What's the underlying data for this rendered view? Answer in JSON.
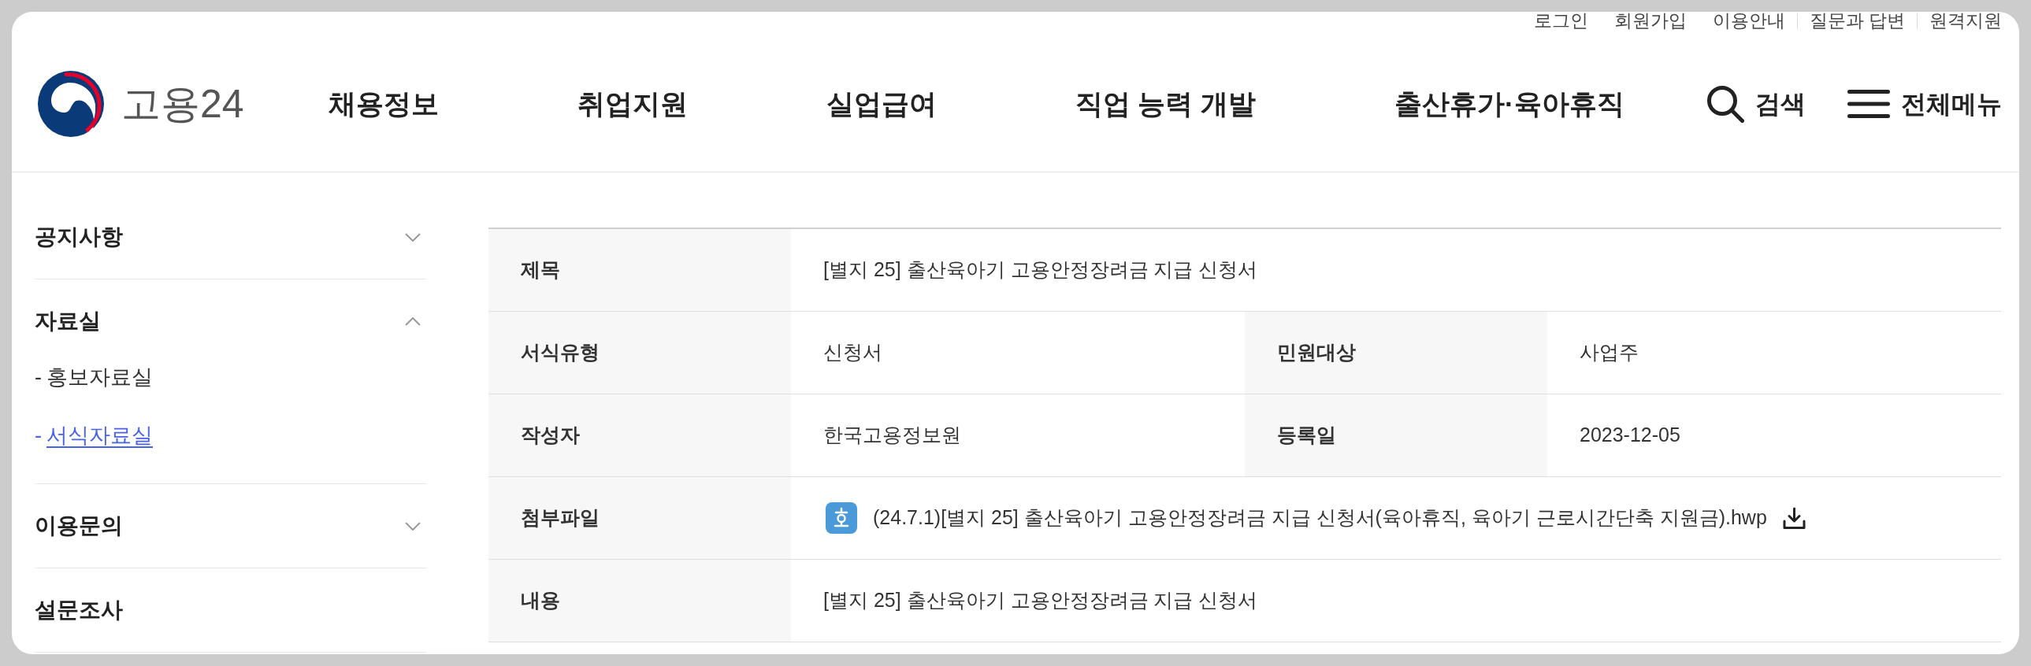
{
  "utility_links": [
    "로그인",
    "회원가입",
    "이용안내",
    "질문과 답변",
    "원격지원"
  ],
  "logo": {
    "text": "고용24"
  },
  "nav": [
    "채용정보",
    "취업지원",
    "실업급여",
    "직업 능력 개발",
    "출산휴가·육아휴직"
  ],
  "header_actions": [
    {
      "kind": "search",
      "label": "검색"
    },
    {
      "kind": "menu",
      "label": "전체메뉴"
    }
  ],
  "sidebar": {
    "items": [
      {
        "kind": "menu",
        "label": "공지사항",
        "expanded": false
      },
      {
        "kind": "menu",
        "label": "자료실",
        "expanded": true,
        "children": [
          {
            "marker": "-",
            "label": "홍보자료실",
            "selected": false
          },
          {
            "marker": "-",
            "label": "서식자료실",
            "selected": true
          }
        ]
      },
      {
        "kind": "menu",
        "label": "이용문의",
        "expanded": false
      },
      {
        "kind": "link",
        "label": "설문조사"
      }
    ]
  },
  "detail_table": {
    "rows": [
      {
        "fields": [
          {
            "kind": "text",
            "label": "제목",
            "value": "[별지 25] 출산육아기 고용안정장려금 지급 신청서"
          }
        ]
      },
      {
        "fields": [
          {
            "kind": "text",
            "label": "서식유형",
            "value": "신청서"
          },
          {
            "kind": "text",
            "label": "민원대상",
            "value": "사업주"
          }
        ]
      },
      {
        "fields": [
          {
            "kind": "text",
            "label": "작성자",
            "value": "한국고용정보원"
          },
          {
            "kind": "text",
            "label": "등록일",
            "value": "2023-12-05"
          }
        ]
      },
      {
        "fields": [
          {
            "kind": "file",
            "label": "첨부파일",
            "value": "(24.7.1)[별지 25] 출산육아기 고용안정장려금 지급 신청서(육아휴직, 육아기 근로시간단축 지원금).hwp"
          }
        ]
      },
      {
        "fields": [
          {
            "kind": "text",
            "label": "내용",
            "value": "[별지 25] 출산육아기 고용안정장려금 지급 신청서"
          }
        ]
      }
    ]
  }
}
